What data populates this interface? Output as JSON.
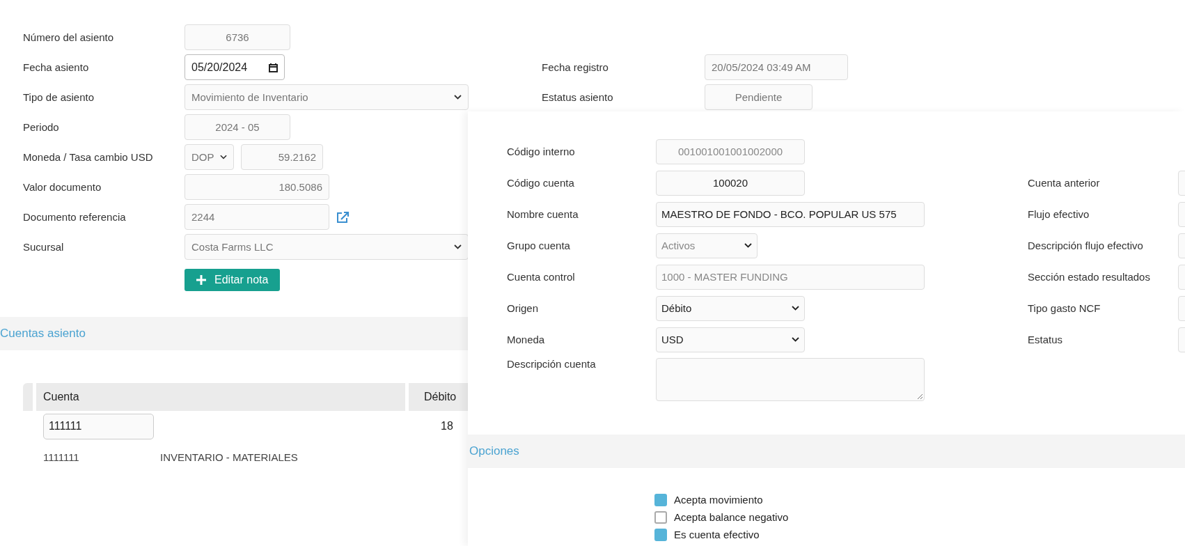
{
  "entry_form": {
    "fields": [
      {
        "label": "Número del asiento",
        "kind": "readonly",
        "value": "6736"
      },
      {
        "label": "Fecha asiento",
        "kind": "date",
        "value": "05/20/2024"
      },
      {
        "label": "Tipo de asiento",
        "kind": "select",
        "value": "Movimiento de Inventario"
      },
      {
        "label": "Periodo",
        "kind": "readonly",
        "value": "2024 - 05"
      },
      {
        "label": "Moneda / Tasa cambio USD",
        "kind": "currency",
        "value": "DOP",
        "rate": "59.2162"
      },
      {
        "label": "Valor documento",
        "kind": "number",
        "value": "180.5086"
      },
      {
        "label": "Documento referencia",
        "kind": "link",
        "value": "2244"
      },
      {
        "label": "Sucursal",
        "kind": "select",
        "value": "Costa Farms LLC"
      }
    ],
    "note_button": "Editar nota",
    "side_fields": [
      {
        "label": "Fecha registro",
        "value": "20/05/2024 03:49 AM"
      },
      {
        "label": "Estatus asiento",
        "value": "Pendiente"
      }
    ]
  },
  "accounts_section": {
    "title": "Cuentas asiento",
    "table": {
      "columns": [
        "Cuenta",
        "Débito"
      ],
      "rows": [
        {
          "kind": "edit",
          "account": "111111",
          "debit": "18"
        },
        {
          "kind": "detail",
          "account": "1111111",
          "name": "INVENTARIO - MATERIALES"
        }
      ]
    }
  },
  "account_panel": {
    "fields": [
      {
        "label": "Código interno",
        "kind": "code",
        "value": "001001001001002000",
        "disabled": true
      },
      {
        "label": "Código cuenta",
        "kind": "code",
        "value": "100020",
        "disabled": false
      },
      {
        "label": "Nombre cuenta",
        "kind": "text",
        "value": "MAESTRO DE FONDO - BCO. POPULAR US 575",
        "disabled": false
      },
      {
        "label": "Grupo cuenta",
        "kind": "select",
        "value": "Activos",
        "disabled": true
      },
      {
        "label": "Cuenta control",
        "kind": "text",
        "value": "1000 - MASTER FUNDING",
        "disabled": true
      },
      {
        "label": "Origen",
        "kind": "select",
        "value": "Débito",
        "disabled": false
      },
      {
        "label": "Moneda",
        "kind": "select",
        "value": "USD",
        "disabled": false
      },
      {
        "label": "Descripción cuenta",
        "kind": "textarea",
        "disabled": false
      }
    ],
    "side_fields": [
      {
        "label": "Cuenta anterior"
      },
      {
        "label": "Flujo efectivo"
      },
      {
        "label": "Descripción flujo efectivo"
      },
      {
        "label": "Sección estado resultados"
      },
      {
        "label": "Tipo gasto NCF"
      },
      {
        "label": "Estatus"
      }
    ],
    "options_title": "Opciones",
    "options": [
      {
        "label": "Acepta movimiento",
        "checked": true
      },
      {
        "label": "Acepta balance negativo",
        "checked": false
      },
      {
        "label": "Es cuenta efectivo",
        "checked": true
      }
    ]
  }
}
